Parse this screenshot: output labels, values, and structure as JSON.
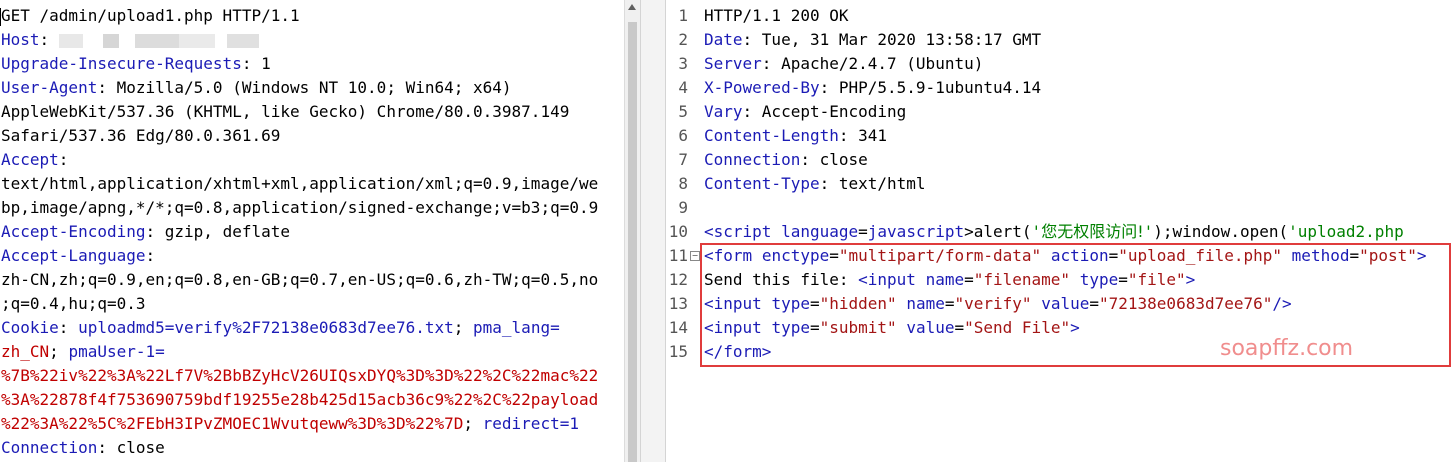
{
  "request": {
    "lines": [
      {
        "text": "GET /admin/upload1.php HTTP/1.1"
      },
      {
        "key": "Host",
        "sep": ": ",
        "value": "",
        "redacted": true
      },
      {
        "key": "Upgrade-Insecure-Requests",
        "sep": ": ",
        "value": "1"
      },
      {
        "key": "User-Agent",
        "sep": ": ",
        "value": "Mozilla/5.0 (Windows NT 10.0; Win64; x64)"
      },
      {
        "text": "AppleWebKit/537.36 (KHTML, like Gecko) Chrome/80.0.3987.149"
      },
      {
        "text": "Safari/537.36 Edg/80.0.361.69"
      },
      {
        "key": "Accept",
        "sep": ":",
        "value": ""
      },
      {
        "text": "text/html,application/xhtml+xml,application/xml;q=0.9,image/we"
      },
      {
        "text": "bp,image/apng,*/*;q=0.8,application/signed-exchange;v=b3;q=0.9"
      },
      {
        "key": "Accept-Encoding",
        "sep": ": ",
        "value": "gzip, deflate"
      },
      {
        "key": "Accept-Language",
        "sep": ":",
        "value": ""
      },
      {
        "text": "zh-CN,zh;q=0.9,en;q=0.8,en-GB;q=0.7,en-US;q=0.6,zh-TW;q=0.5,no"
      },
      {
        "text": ";q=0.4,hu;q=0.3"
      }
    ],
    "cookie": {
      "label": "Cookie",
      "sep": ": ",
      "line1_key": "uploadmd5=verify%2F72138e0683d7ee76.txt",
      "line1_sep": "; ",
      "line1_key2": "pma_lang=",
      "line2_a": "zh_CN",
      "line2_sep": "; ",
      "line2_b": "pmaUser-1=",
      "line3": "%7B%22iv%22%3A%22Lf7V%2BbBZyHcV26UIQsxDYQ%3D%3D%22%2C%22mac%22",
      "line4": "%3A%22878f4f753690759bdf19255e28b425d15acb36c9%22%2C%22payload",
      "line5_a": "%22%3A%22%5C%2FEbH3IPvZMOEC1Wvutqeww%3D%3D%22%7D",
      "line5_sep": "; ",
      "line5_b": "redirect=1"
    },
    "connection": {
      "key": "Connection",
      "sep": ": ",
      "value": "close"
    }
  },
  "response": {
    "numbers": [
      "1",
      "2",
      "3",
      "4",
      "5",
      "6",
      "7",
      "8",
      "9",
      "10",
      "11",
      "12",
      "13",
      "14",
      "15"
    ],
    "fold_glyph": "−",
    "status": "HTTP/1.1 200 OK",
    "headers": [
      {
        "key": "Date",
        "sep": ": ",
        "value": "Tue, 31 Mar 2020 13:58:17 GMT"
      },
      {
        "key": "Server",
        "sep": ": ",
        "value": "Apache/2.4.7 (Ubuntu)"
      },
      {
        "key": "X-Powered-By",
        "sep": ": ",
        "value": "PHP/5.5.9-1ubuntu4.14"
      },
      {
        "key": "Vary",
        "sep": ": ",
        "value": "Accept-Encoding"
      },
      {
        "key": "Content-Length",
        "sep": ": ",
        "value": "341"
      },
      {
        "key": "Connection",
        "sep": ": ",
        "value": "close"
      },
      {
        "key": "Content-Type",
        "sep": ": ",
        "value": "text/html"
      }
    ],
    "l10": {
      "lt": "<",
      "tag": "script",
      "attr": "language",
      "eq": "=",
      "attrval": "javascript",
      "gt": ">",
      "call1": "alert(",
      "str1_open": "'",
      "str1": "您无权限访问!",
      "str1_close": "'",
      "mid": ");window.open(",
      "str2": "'upload2.php"
    },
    "l11": {
      "open": "<form",
      "a1": "enctype",
      "v1": "\"multipart/form-data\"",
      "a2": "action",
      "v2": "\"upload_file.php\"",
      "a3": "method",
      "v3": "\"post\"",
      "gt": ">"
    },
    "l12": {
      "text": "Send this file: ",
      "open": "<input",
      "a1": "name",
      "v1": "\"filename\"",
      "a2": "type",
      "v2": "\"file\"",
      "gt": ">"
    },
    "l13": {
      "open": "<input",
      "a1": "type",
      "v1": "\"hidden\"",
      "a2": "name",
      "v2": "\"verify\"",
      "a3": "value",
      "v3": "\"72138e0683d7ee76\"",
      "gt": "/>"
    },
    "l14": {
      "open": "<input",
      "a1": "type",
      "v1": "\"submit\"",
      "a2": "value",
      "v2": "\"Send File\"",
      "gt": ">"
    },
    "l15": {
      "close": "</form>"
    },
    "watermark": "soapffz.com"
  },
  "colors": {
    "keyword": "#1b1bb5",
    "cookie_value": "#c00000",
    "string": "#a31515",
    "highlight": "#e03c3c",
    "watermark": "#f08d8d"
  }
}
